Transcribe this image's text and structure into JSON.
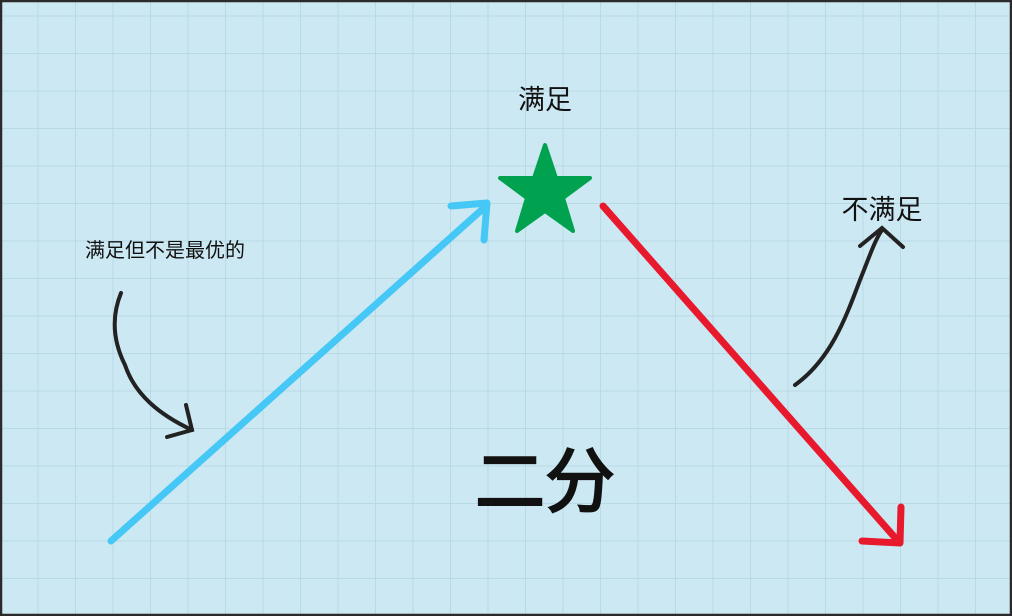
{
  "labels": {
    "top": "满足",
    "right": "不满足",
    "left": "满足但不是最优的",
    "center": "二分"
  },
  "colors": {
    "background": "#cce8f2",
    "grid": "#b8dae5",
    "up_arrow": "#45c8f5",
    "down_arrow": "#e8192c",
    "star": "#00a24f",
    "pointer": "#222222"
  },
  "icons": [
    "star-icon"
  ]
}
